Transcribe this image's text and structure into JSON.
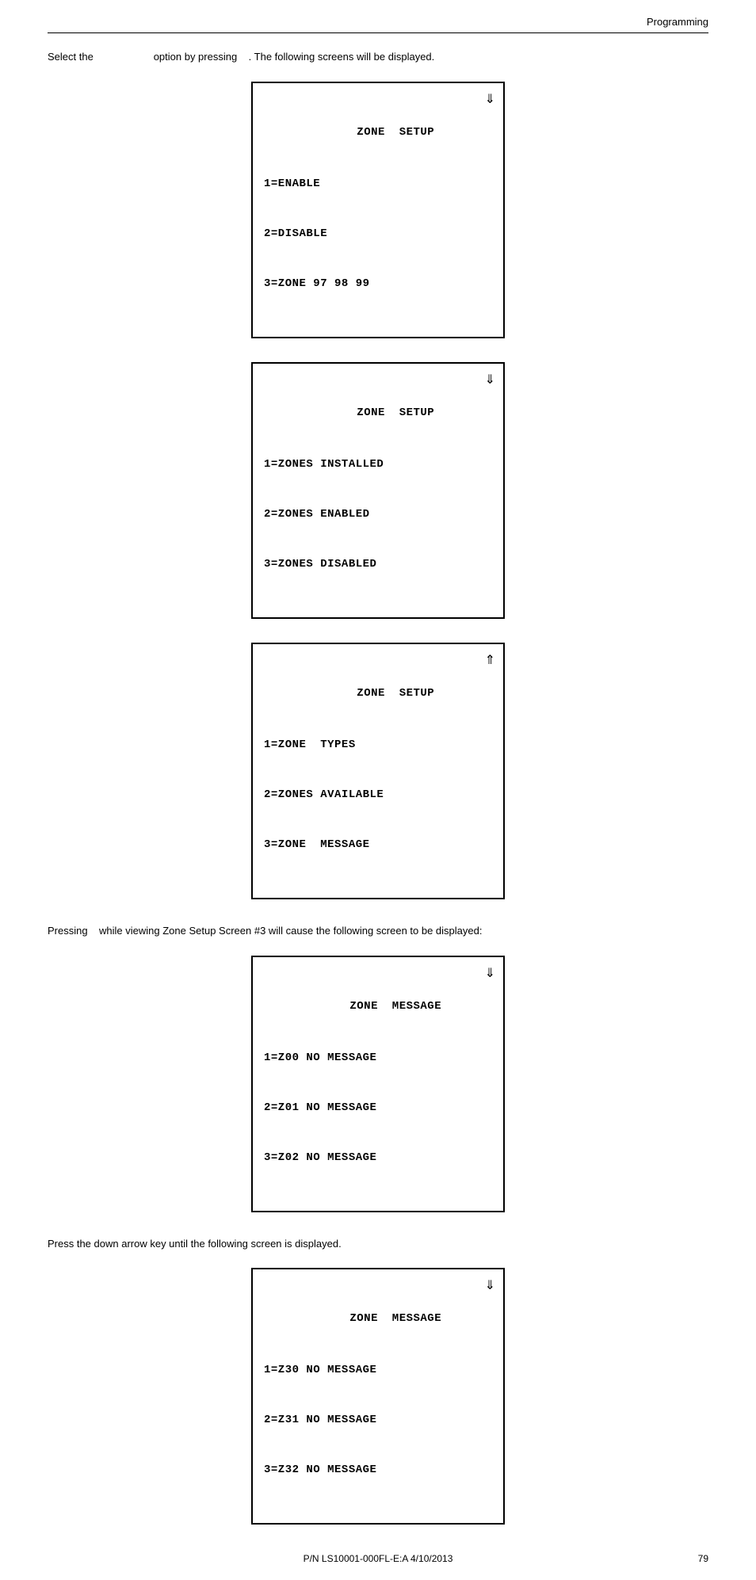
{
  "header": {
    "title": "Programming"
  },
  "intro": {
    "text_part1": "Select the",
    "text_part2": "option by pressing",
    "text_part3": ".  The following screens will be displayed."
  },
  "screens": [
    {
      "id": "screen1",
      "title": "     ZONE  SETUP",
      "lines": [
        "1=ENABLE",
        "2=DISABLE",
        "3=ZONE 97 98 99"
      ],
      "scroll": "down"
    },
    {
      "id": "screen2",
      "title": "     ZONE  SETUP",
      "lines": [
        "1=ZONES INSTALLED",
        "2=ZONES ENABLED",
        "3=ZONES DISABLED"
      ],
      "scroll": "down"
    },
    {
      "id": "screen3",
      "title": "     ZONE  SETUP",
      "lines": [
        "1=ZONE  TYPES",
        "2=ZONES AVAILABLE",
        "3=ZONE  MESSAGE"
      ],
      "scroll": "up"
    }
  ],
  "pressing_text": {
    "part1": "Pressing",
    "part2": "while viewing Zone Setup Screen #3 will cause the following screen to be displayed:"
  },
  "screen4": {
    "title": "     ZONE  MESSAGE",
    "lines": [
      "1=Z00 NO MESSAGE",
      "2=Z01 NO MESSAGE",
      "3=Z02 NO MESSAGE"
    ],
    "scroll": "down"
  },
  "down_arrow_text": "Press the down arrow key until the following screen is displayed.",
  "screen5": {
    "title": "     ZONE  MESSAGE",
    "lines": [
      "1=Z30 NO MESSAGE",
      "2=Z31 NO MESSAGE",
      "3=Z32 NO MESSAGE"
    ],
    "scroll": "down"
  },
  "footer": {
    "part_number": "P/N LS10001-000FL-E:A  4/10/2013",
    "page_number": "79"
  }
}
